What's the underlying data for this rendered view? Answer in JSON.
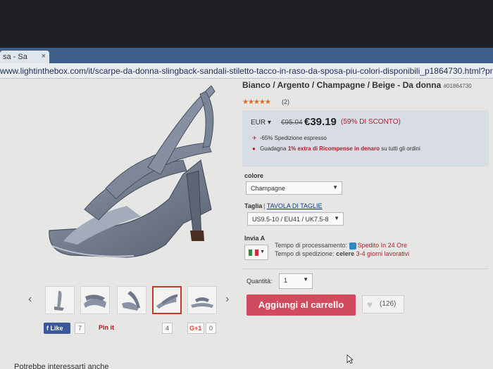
{
  "browser": {
    "tab_title": "sa - Sa",
    "tab_close": "×",
    "url": "www.lightinthebox.com/it/scarpe-da-donna-slingback-sandali-stiletto-tacco-in-raso-da-sposa-piu-colori-disponibili_p1864730.html?prm"
  },
  "product": {
    "title": "Bianco / Argento / Champagne / Beige - Da donna",
    "sku": "#01864730",
    "rating_stars": "★★★★★",
    "reviews": "(2)"
  },
  "price": {
    "currency": "EUR",
    "old": "€95.04",
    "new": "€39.19",
    "discount": "(59% DI SCONTO)",
    "shipping": "-65% Spedizione espresso",
    "earn_prefix": "Guadagna",
    "earn_highlight": "1% extra di Ricompense in denaro",
    "earn_suffix": "su tutti gli ordini"
  },
  "options": {
    "color_label": "colore",
    "color_value": "Champagne",
    "size_label": "Taglia",
    "size_chart": "TAVOLA DI TAGLIE",
    "size_value": "US9.5-10 / EU41 / UK7.5-8",
    "ship_label": "Invia A",
    "processing_label": "Tempo di processamento:",
    "processing_value": "Spedito In 24 Ore",
    "shipping_time_label": "Tempo di spedizione:",
    "shipping_time_value_a": "celere",
    "shipping_time_value_b": "3-4 giorni lavorativi",
    "quantity_label": "Quantità:",
    "quantity_value": "1"
  },
  "actions": {
    "add_to_cart": "Aggiungi al carrello",
    "wishlist_count": "(126)"
  },
  "social": {
    "like_label": "Like",
    "like_count": "7",
    "pin_label": "Pin it",
    "pin_count": "4",
    "gplus_label": "G+1",
    "gplus_count": "0"
  },
  "footer": {
    "teaser": "Potrebbe interessarti anche"
  },
  "colors": {
    "accent": "#d24a5d",
    "price_red": "#b01c2e"
  }
}
